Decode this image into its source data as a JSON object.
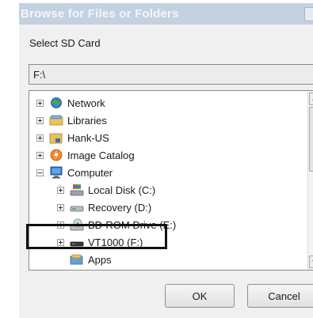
{
  "window": {
    "title": "Browse for Files or Folders"
  },
  "prompt": "Select SD Card",
  "path_value": "F:\\",
  "tree": [
    {
      "label": "Network",
      "icon": "network-icon",
      "expander": "plus"
    },
    {
      "label": "Libraries",
      "icon": "libraries-icon",
      "expander": "plus"
    },
    {
      "label": "Hank-US",
      "icon": "user-folder-icon",
      "expander": "plus"
    },
    {
      "label": "Image Catalog",
      "icon": "image-catalog-icon",
      "expander": "plus"
    },
    {
      "label": "Computer",
      "icon": "computer-icon",
      "expander": "minus"
    },
    {
      "label": "Local Disk (C:)",
      "icon": "local-disk-icon",
      "expander": "plus"
    },
    {
      "label": "Recovery (D:)",
      "icon": "drive-icon",
      "expander": "plus"
    },
    {
      "label": "BD-ROM Drive (E:)",
      "icon": "optical-drive-icon",
      "expander": "plus"
    },
    {
      "label": "VT1000 (F:)",
      "icon": "removable-drive-icon",
      "expander": "plus"
    },
    {
      "label": "Apps",
      "icon": "apps-folder-icon",
      "expander": "none"
    }
  ],
  "buttons": {
    "ok": "OK",
    "cancel": "Cancel"
  },
  "colors": {
    "titlebar": "#c3d1e0",
    "highlight_border": "#111111"
  }
}
